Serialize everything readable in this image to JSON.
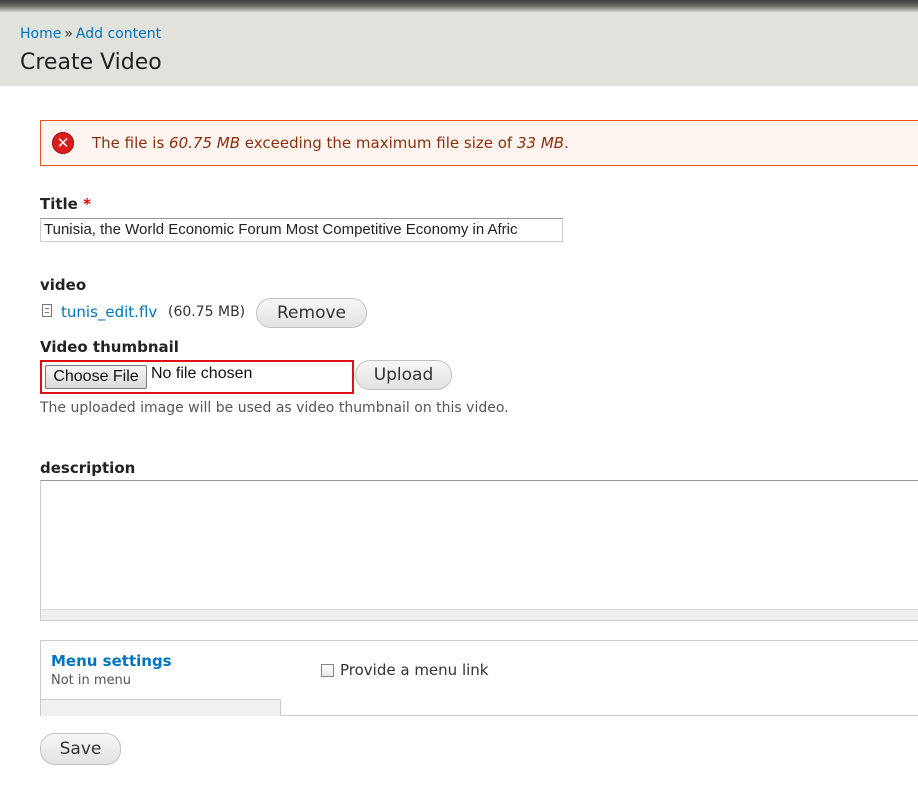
{
  "breadcrumb": {
    "home": "Home",
    "separator": "»",
    "add_content": "Add content"
  },
  "page": {
    "title": "Create Video"
  },
  "error": {
    "prefix": "The file is",
    "file_size": "60.75 MB",
    "middle": "exceeding the maximum file size of",
    "max_size": "33 MB",
    "suffix": "."
  },
  "title_field": {
    "label": "Title",
    "required_mark": "*",
    "value": "Tunisia, the World Economic Forum Most Competitive Economy in Afric"
  },
  "video_field": {
    "label": "video",
    "file_name": "tunis_edit.flv",
    "file_size": "(60.75 MB)",
    "remove_label": "Remove"
  },
  "thumbnail_field": {
    "label": "Video thumbnail",
    "choose_label": "Choose File",
    "no_file": "No file chosen",
    "upload_label": "Upload",
    "help": "The uploaded image will be used as video thumbnail on this video."
  },
  "description_field": {
    "label": "description",
    "value": ""
  },
  "menu_settings": {
    "title": "Menu settings",
    "summary": "Not in menu",
    "checkbox_label": "Provide a menu link",
    "checked": false
  },
  "actions": {
    "save_label": "Save"
  },
  "colors": {
    "link": "#0074bd",
    "error_border": "#ed541d",
    "error_bg": "#fef5f1",
    "error_text": "#8c2e0b",
    "invalid_border": "#dd1111",
    "header_bg": "#e1e2dc"
  }
}
